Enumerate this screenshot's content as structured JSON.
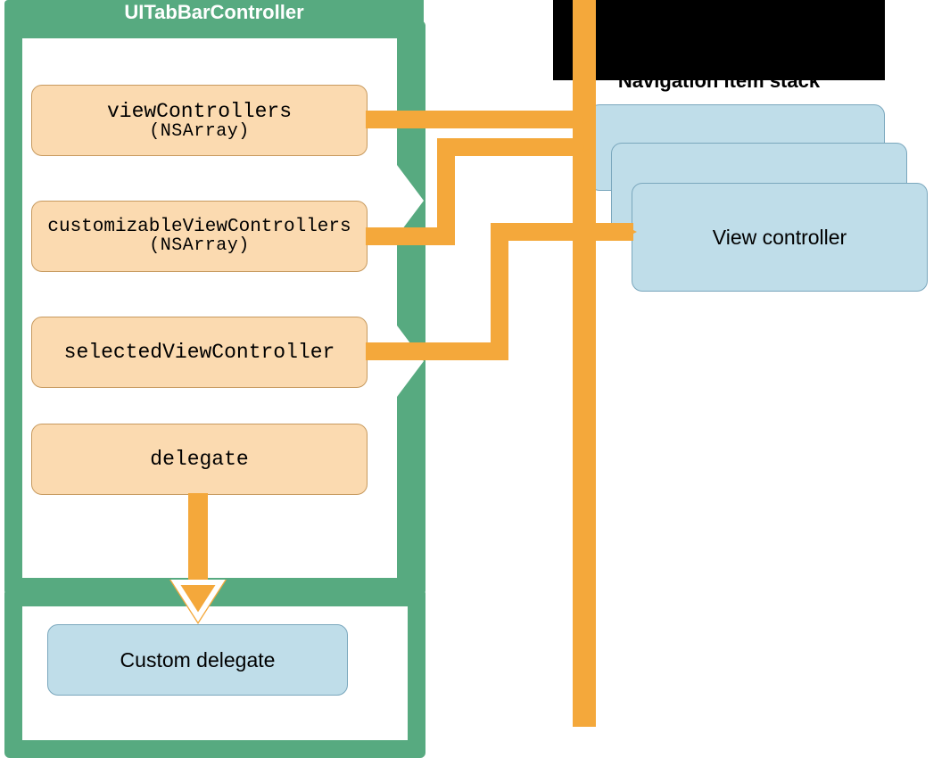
{
  "controllerTitle": "UITabBarController",
  "rightSideTitle": "Navigation item stack",
  "boxes": {
    "viewControllers": {
      "label": "viewControllers",
      "subtype": "(NSArray)"
    },
    "customizable": {
      "label": "customizableViewControllers",
      "subtype": "(NSArray)"
    },
    "selected": {
      "label": "selectedViewController"
    },
    "delegate": {
      "label": "delegate"
    },
    "customDelegate": {
      "label": "Custom delegate"
    },
    "viewController": {
      "label": "View controller"
    }
  },
  "colors": {
    "green": "#57aa80",
    "orange": "#f4a83b",
    "orangeFill": "#fbdab0",
    "blueFill": "#bfdde9"
  }
}
